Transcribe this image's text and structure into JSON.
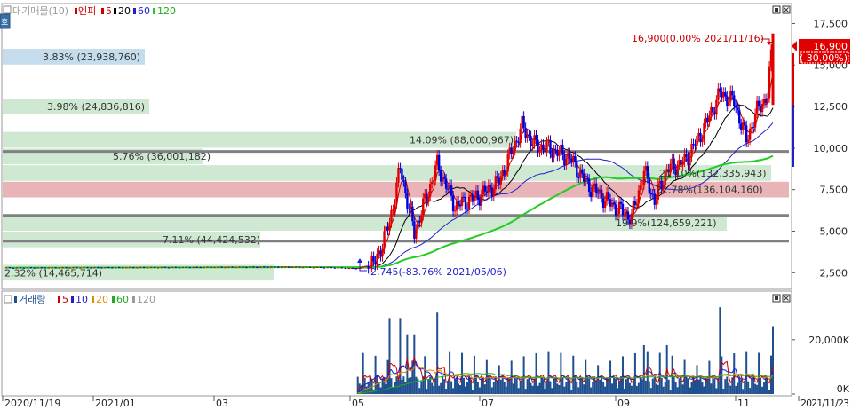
{
  "price_panel": {
    "legend": {
      "title": "대기매물(10)",
      "items": [
        {
          "text": "엔피",
          "color": "#cc0000"
        },
        {
          "text": "5",
          "color": "#cc0000"
        },
        {
          "text": "20",
          "color": "#000000"
        },
        {
          "text": "60",
          "color": "#1f1fcc"
        },
        {
          "text": "120",
          "color": "#22cc22"
        }
      ]
    },
    "side_button": "호"
  },
  "volume_panel": {
    "legend": {
      "title": "거래량",
      "items": [
        {
          "text": "5",
          "color": "#cc0000"
        },
        {
          "text": "10",
          "color": "#1f1fcc"
        },
        {
          "text": "20",
          "color": "#e08a00"
        },
        {
          "text": "60",
          "color": "#22aa22"
        },
        {
          "text": "120",
          "color": "#999999"
        }
      ]
    }
  },
  "chart_data": [
    {
      "type": "candlestick",
      "ylim": [
        1500,
        18700
      ],
      "y_ticks": [
        2500,
        5000,
        7500,
        10000,
        12500,
        15000,
        17500
      ],
      "y_tick_labels": [
        "2,500",
        "5,000",
        "7,500",
        "10,000",
        "12,500",
        "15,000",
        "17,500"
      ],
      "x_tick_labels": [
        "2020/11/19",
        "2021/01",
        "03",
        "05",
        "07",
        "09",
        "11",
        "2021/11/23"
      ],
      "current_price": {
        "value": 16900,
        "label": "16,900",
        "pct": "( 30.00%)"
      },
      "high_annotation": "16,900(0.00% 2021/11/16)",
      "low_annotation": "2,745(-83.76% 2021/05/06)",
      "supply_bands": [
        {
          "low": 2000,
          "high": 3000,
          "label": "2.32% (14,465,714)",
          "highlight": false
        },
        {
          "low": 3000,
          "high": 4000,
          "label": "",
          "highlight": false
        },
        {
          "low": 4000,
          "high": 5000,
          "label": "7.11% (44,424,532)",
          "highlight": false
        },
        {
          "low": 5000,
          "high": 6000,
          "label": "19.9%(124,659,221)",
          "highlight": false
        },
        {
          "low": 6000,
          "high": 7000,
          "label": "",
          "highlight": false
        },
        {
          "low": 7000,
          "high": 8000,
          "label": "21.78%(136,104,160)",
          "highlight": true
        },
        {
          "low": 8000,
          "high": 9000,
          "label": "21.10%(132,335,943)",
          "highlight": false
        },
        {
          "low": 9000,
          "high": 10000,
          "label": "5.76% (36,001,182)",
          "highlight": false
        },
        {
          "low": 10000,
          "high": 11000,
          "label": "14.09% (88,000,967)",
          "highlight": false
        },
        {
          "low": 11000,
          "high": 12000,
          "label": "",
          "highlight": false
        },
        {
          "low": 12000,
          "high": 13000,
          "label": "3.98% (24,836,816)",
          "highlight": false
        },
        {
          "low": 13000,
          "high": 14000,
          "label": "",
          "highlight": false
        },
        {
          "low": 14000,
          "high": 15000,
          "label": "",
          "highlight": false
        },
        {
          "low": 15000,
          "high": 16000,
          "label": "3.83% (23,938,760)",
          "highlight": false
        }
      ],
      "horizontal_lines": [
        9800,
        5950,
        4400
      ],
      "series": [
        {
          "name": "5",
          "color": "#cc0000"
        },
        {
          "name": "20",
          "color": "#000000"
        },
        {
          "name": "60",
          "color": "#1f1fcc"
        },
        {
          "name": "120",
          "color": "#22cc22"
        }
      ]
    },
    {
      "type": "bar",
      "title": "거래량",
      "ylim": [
        0,
        34000
      ],
      "y_ticks": [
        0,
        20000
      ],
      "y_tick_labels": [
        "0K",
        "20,000K"
      ]
    }
  ]
}
